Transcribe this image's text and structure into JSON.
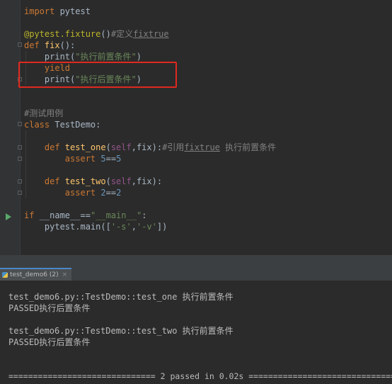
{
  "code": {
    "l1": {
      "a": "import",
      "b": " pytest"
    },
    "l3": {
      "a": "@pytest.fixture",
      "b": "()",
      "c": "#定义",
      "d": "fixtrue"
    },
    "l4": {
      "a": "def ",
      "b": "fix",
      "c": "():"
    },
    "l5": {
      "a": "    print(",
      "b": "\"执行前置条件\"",
      "c": ")"
    },
    "l6": {
      "a": "    yield"
    },
    "l7": {
      "a": "    print(",
      "b": "\"执行后置条件\"",
      "c": ")"
    },
    "l10": {
      "a": "#测试用例"
    },
    "l11": {
      "a": "class ",
      "b": "TestDemo:"
    },
    "l13": {
      "a": "    def ",
      "b": "test_one",
      "c": "(",
      "d": "self",
      "e": ",fix):",
      "f": "#引用",
      "g": "fixtrue",
      "h": " 执行前置条件"
    },
    "l14": {
      "a": "        assert ",
      "b": "5",
      "c": "==",
      "d": "5"
    },
    "l16": {
      "a": "    def ",
      "b": "test_two",
      "c": "(",
      "d": "self",
      "e": ",fix):"
    },
    "l17": {
      "a": "        assert ",
      "b": "2",
      "c": "==",
      "d": "2"
    },
    "l19": {
      "a": "if ",
      "b": "__name__==",
      "c": "\"__main__\"",
      "d": ":"
    },
    "l20": {
      "a": "    pytest.main([",
      "b": "'-s'",
      "c": ",",
      "d": "'-v'",
      "e": "])"
    }
  },
  "run_tab": {
    "label": "test_demo6 (2)",
    "close": "×"
  },
  "console": {
    "line1": "test_demo6.py::TestDemo::test_one 执行前置条件",
    "line2": "PASSED执行后置条件",
    "line3": "test_demo6.py::TestDemo::test_two 执行前置条件",
    "line4": "PASSED执行后置条件",
    "summary": "============================== 2 passed in 0.02s =============================="
  },
  "colors": {
    "keyword": "#cc7832",
    "decorator": "#bbb529",
    "function": "#ffc66d",
    "string": "#6a8759",
    "number": "#6897bb",
    "comment": "#808080",
    "highlight_box": "#e0291f"
  },
  "icons": {
    "run": "run-gutter-icon",
    "tab": "python-file-icon",
    "close": "close-icon"
  }
}
